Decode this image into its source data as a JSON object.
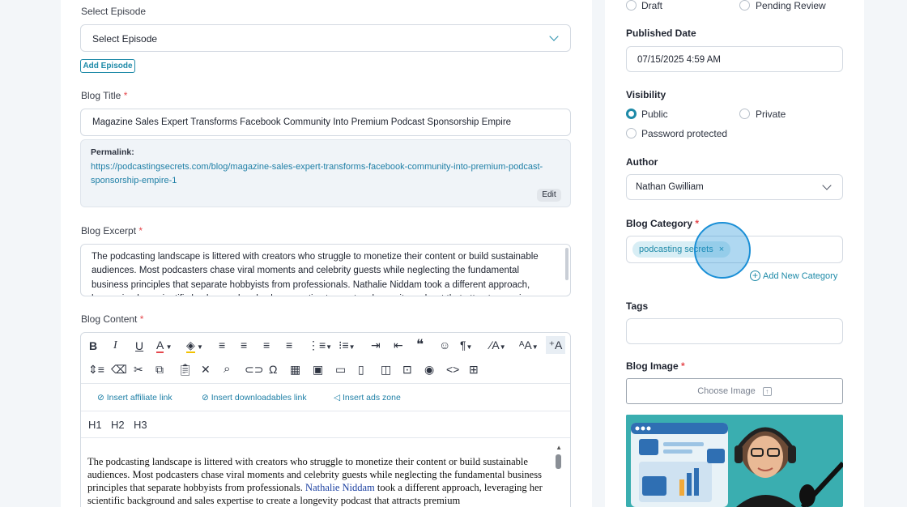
{
  "episode": {
    "label": "Select Episode",
    "select_value": "Select Episode",
    "add_button": "Add Episode"
  },
  "title": {
    "label": "Blog Title",
    "required": "*",
    "value": "Magazine Sales Expert Transforms Facebook Community Into Premium Podcast Sponsorship Empire"
  },
  "permalink": {
    "label": "Permalink:",
    "url_line1": "https://podcastingsecrets.com/blog/magazine-sales-expert-transforms-facebook-community-into-premium-podcast-",
    "url_line2": "sponsorship-empire-1",
    "edit_label": "Edit"
  },
  "excerpt": {
    "label": "Blog Excerpt",
    "required": "*",
    "text": "The podcasting landscape is littered with creators who struggle to monetize their content or build sustainable audiences. Most podcasters chase viral moments and celebrity guests while neglecting the fundamental business principles that separate hobbyists from professionals. Nathalie Niddam took a different approach, leveraging her scientific background and sales expertise to create a longevity podcast that attracts premium"
  },
  "content": {
    "label": "Blog Content",
    "required": "*",
    "insert_affiliate": "Insert affiliate link",
    "insert_downloadables": "Insert downloadables link",
    "insert_ads": "Insert ads zone",
    "h1": "H1",
    "h2": "H2",
    "h3": "H3",
    "text_before": "The podcasting landscape is littered with creators who struggle to monetize their content or build sustainable audiences. Most podcasters chase viral moments and celebrity guests while neglecting the fundamental business principles that separate hobbyists from professionals. ",
    "text_name": "Nathalie Niddam",
    "text_after": " took a different approach, leveraging her scientific background and sales expertise to create a longevity podcast that attracts premium"
  },
  "status": {
    "draft": "Draft",
    "pending": "Pending Review"
  },
  "published": {
    "label": "Published Date",
    "value": "07/15/2025 4:59 AM"
  },
  "visibility": {
    "label": "Visibility",
    "public": "Public",
    "private": "Private",
    "password": "Password protected",
    "selected": "Public"
  },
  "author": {
    "label": "Author",
    "value": "Nathan Gwilliam"
  },
  "category": {
    "label": "Blog Category",
    "required": "*",
    "chip": "podcasting secrets",
    "chip_remove": "×",
    "add_new": "Add New Category"
  },
  "tags": {
    "label": "Tags"
  },
  "image": {
    "label": "Blog Image",
    "required": "*",
    "choose": "Choose Image"
  },
  "colors": {
    "accent": "#1e8aa8",
    "link": "#1e7fa6",
    "required": "#e5484d"
  },
  "icons": [
    "chevron-down-icon",
    "link-icon",
    "megaphone-icon",
    "plus-circle-icon",
    "upload-icon",
    "bold-icon",
    "italic-icon",
    "underline-icon"
  ]
}
